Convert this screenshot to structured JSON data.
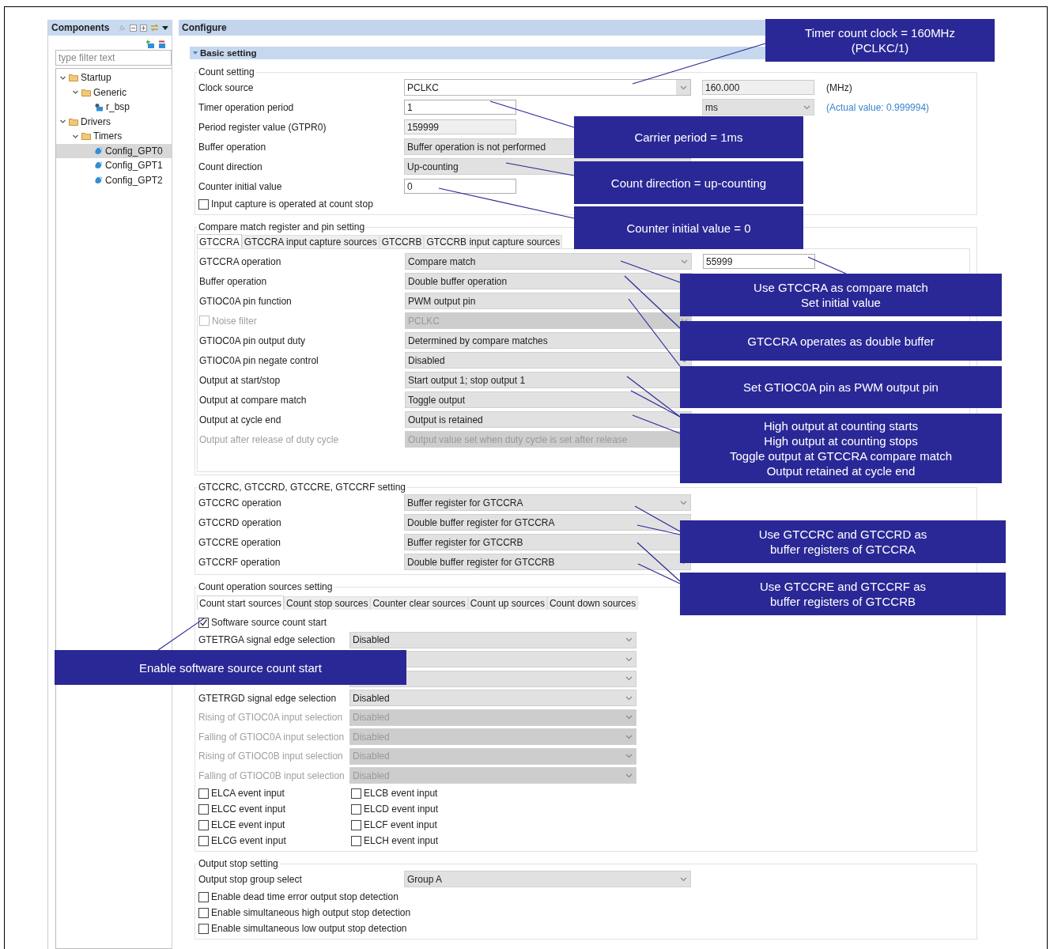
{
  "components": {
    "title": "Components",
    "filter": {
      "placeholder": "type filter text"
    },
    "tree": [
      {
        "label": "Startup",
        "kind": "folder",
        "expanded": true,
        "selected": false,
        "children": [
          {
            "label": "Generic",
            "kind": "folder",
            "expanded": true,
            "selected": false,
            "children": [
              {
                "label": "r_bsp",
                "kind": "module",
                "selected": false
              }
            ]
          }
        ]
      },
      {
        "label": "Drivers",
        "kind": "folder",
        "expanded": true,
        "selected": false,
        "children": [
          {
            "label": "Timers",
            "kind": "folder",
            "expanded": true,
            "selected": false,
            "children": [
              {
                "label": "Config_GPT0",
                "kind": "config",
                "selected": true
              },
              {
                "label": "Config_GPT1",
                "kind": "config",
                "selected": false
              },
              {
                "label": "Config_GPT2",
                "kind": "config",
                "selected": false
              }
            ]
          }
        ]
      }
    ]
  },
  "configure": {
    "title": "Configure",
    "section": {
      "title": "Basic setting",
      "expanded": true,
      "groups": [
        {
          "kind": "form",
          "title": "Count setting",
          "rows": [
            {
              "kind": "combo",
              "label": "Clock source",
              "value": "PCLKC",
              "extra": {
                "kind": "readonly",
                "value": "160.000"
              },
              "unit": "(MHz)"
            },
            {
              "kind": "input",
              "label": "Timer operation period",
              "value": "1",
              "extra": {
                "kind": "select",
                "value": "ms"
              },
              "note": "(Actual value: 0.999994)"
            },
            {
              "kind": "readonly",
              "label": "Period register value (GTPR0)",
              "value": "159999"
            },
            {
              "kind": "field",
              "label": "Buffer operation",
              "value": "Buffer operation is not performed"
            },
            {
              "kind": "field",
              "label": "Count direction",
              "value": "Up-counting"
            },
            {
              "kind": "input",
              "label": "Counter initial value",
              "value": "0"
            },
            {
              "kind": "checkbox",
              "label": "Input capture is operated at count stop",
              "checked": false
            }
          ]
        },
        {
          "kind": "tabbed",
          "title": "Compare match register and pin setting",
          "tabs": [
            {
              "label": "GTCCRA",
              "selected": true
            },
            {
              "label": "GTCCRA input capture sources",
              "selected": false
            },
            {
              "label": "GTCCRB",
              "selected": false
            },
            {
              "label": "GTCCRB input capture sources",
              "selected": false
            }
          ],
          "rows": [
            {
              "kind": "select",
              "label": "GTCCRA operation",
              "value": "Compare match",
              "extra": {
                "kind": "input",
                "value": "55999"
              }
            },
            {
              "kind": "field",
              "label": "Buffer operation",
              "value": "Double buffer operation"
            },
            {
              "kind": "field",
              "label": "GTIOC0A pin function",
              "value": "PWM output pin"
            },
            {
              "kind": "checkselect",
              "label": "Noise filter",
              "value": "PCLKC",
              "checked": false,
              "disabled": true
            },
            {
              "kind": "select",
              "label": "GTIOC0A pin output duty",
              "value": "Determined by compare matches"
            },
            {
              "kind": "select",
              "label": "GTIOC0A pin negate control",
              "value": "Disabled"
            },
            {
              "kind": "select",
              "label": "Output at start/stop",
              "value": "Start output 1; stop output 1"
            },
            {
              "kind": "select",
              "label": "Output at compare match",
              "value": "Toggle output"
            },
            {
              "kind": "select",
              "label": "Output at cycle end",
              "value": "Output is retained"
            },
            {
              "kind": "select",
              "label": "Output after release of duty cycle",
              "value": "Output value set when duty cycle is set after release",
              "disabled": true
            }
          ]
        },
        {
          "kind": "form",
          "title": "GTCCRC, GTCCRD, GTCCRE, GTCCRF setting",
          "rows": [
            {
              "kind": "select",
              "label": "GTCCRC operation",
              "value": "Buffer register for GTCCRA"
            },
            {
              "kind": "select",
              "label": "GTCCRD operation",
              "value": "Double buffer register for GTCCRA"
            },
            {
              "kind": "select",
              "label": "GTCCRE operation",
              "value": "Buffer register for GTCCRB"
            },
            {
              "kind": "select",
              "label": "GTCCRF operation",
              "value": "Double buffer register for GTCCRB"
            }
          ]
        },
        {
          "kind": "sources",
          "title": "Count operation sources setting",
          "tabs": [
            {
              "label": "Count start sources",
              "selected": true
            },
            {
              "label": "Count stop sources",
              "selected": false
            },
            {
              "label": "Counter clear sources",
              "selected": false
            },
            {
              "label": "Count up sources",
              "selected": false
            },
            {
              "label": "Count down sources",
              "selected": false
            }
          ],
          "rows": [
            {
              "kind": "checkbox",
              "label": "Software source count start",
              "checked": true
            },
            {
              "kind": "select",
              "label": "GTETRGA signal edge selection",
              "value": "Disabled"
            },
            {
              "kind": "select"
            },
            {
              "kind": "select"
            },
            {
              "kind": "select",
              "label": "GTETRGD signal edge selection",
              "value": "Disabled"
            },
            {
              "kind": "select",
              "label": "Rising of GTIOC0A input selection",
              "value": "Disabled",
              "disabled": true
            },
            {
              "kind": "select",
              "label": "Falling of GTIOC0A input selection",
              "value": "Disabled",
              "disabled": true
            },
            {
              "kind": "select",
              "label": "Rising of GTIOC0B input selection",
              "value": "Disabled",
              "disabled": true
            },
            {
              "kind": "select",
              "label": "Falling of GTIOC0B input selection",
              "value": "Disabled",
              "disabled": true
            }
          ],
          "events": [
            {
              "label": "ELCA event input",
              "checked": false
            },
            {
              "label": "ELCB event input",
              "checked": false
            },
            {
              "label": "ELCC event input",
              "checked": false
            },
            {
              "label": "ELCD event input",
              "checked": false
            },
            {
              "label": "ELCE event input",
              "checked": false
            },
            {
              "label": "ELCF event input",
              "checked": false
            },
            {
              "label": "ELCG event input",
              "checked": false
            },
            {
              "label": "ELCH event input",
              "checked": false
            }
          ]
        },
        {
          "kind": "form",
          "title": "Output stop setting",
          "rows": [
            {
              "kind": "select",
              "label": "Output stop group select",
              "value": "Group A"
            },
            {
              "kind": "checkbox",
              "label": "Enable dead time error output stop detection",
              "checked": false
            },
            {
              "kind": "checkbox",
              "label": "Enable simultaneous high output stop detection",
              "checked": false
            },
            {
              "kind": "checkbox",
              "label": "Enable simultaneous low output stop detection",
              "checked": false
            }
          ]
        }
      ]
    }
  },
  "callouts": [
    {
      "text": "Timer count clock = 160MHz\n(PCLKC/1)"
    },
    {
      "text": "Carrier period = 1ms"
    },
    {
      "text": "Count direction = up-counting"
    },
    {
      "text": "Counter initial value = 0"
    },
    {
      "text": "Use GTCCRA as compare match\nSet initial value"
    },
    {
      "text": "GTCCRA operates as double buffer"
    },
    {
      "text": "Set GTIOC0A pin as PWM output pin"
    },
    {
      "text": "High output at counting starts\nHigh output at counting stops\nToggle output at GTCCRA compare match\nOutput retained at cycle end"
    },
    {
      "text": "Use GTCCRC and GTCCRD as\nbuffer registers of GTCCRA"
    },
    {
      "text": "Use GTCCRE and GTCCRF as\nbuffer registers of GTCCRB"
    },
    {
      "text": "Enable software source count start"
    }
  ]
}
